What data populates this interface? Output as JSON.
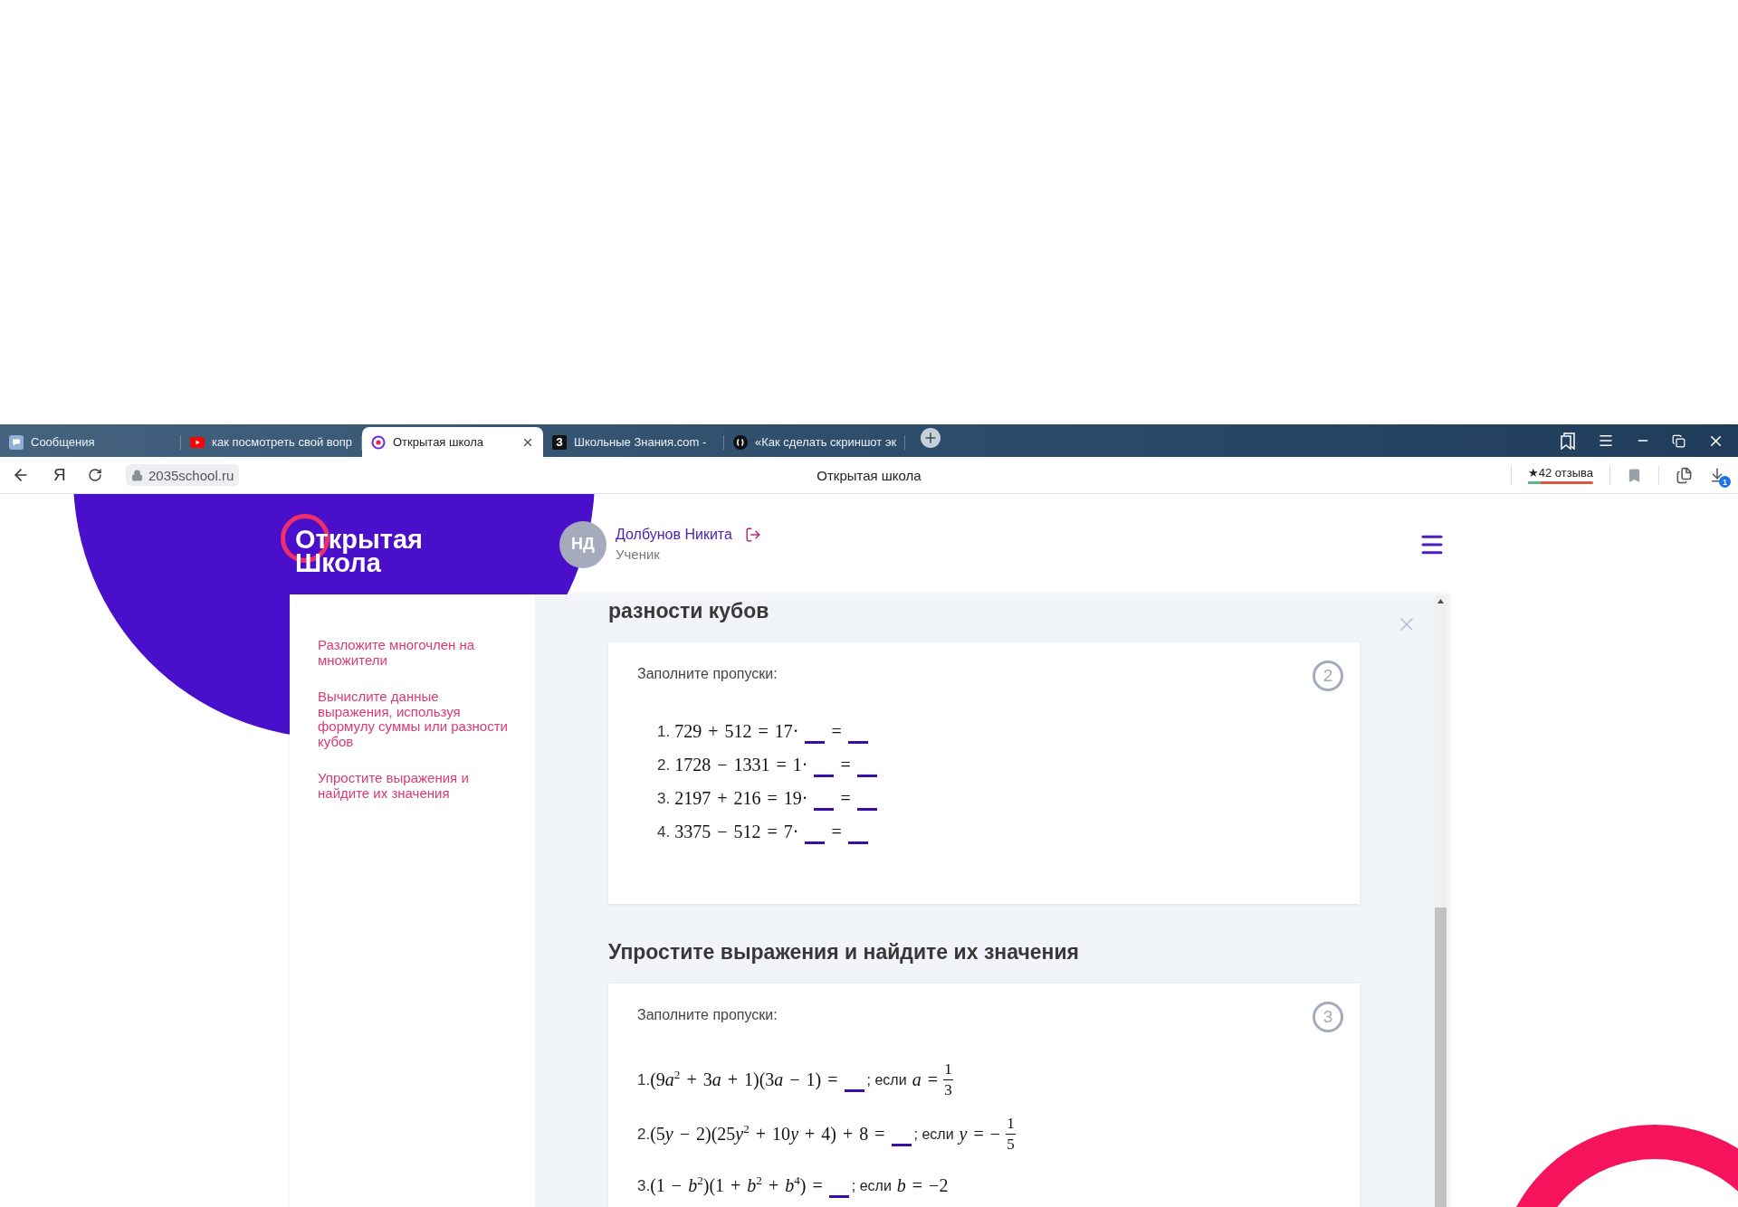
{
  "browser": {
    "tabs": [
      {
        "title": "Сообщения",
        "kind": "messages",
        "selected": false
      },
      {
        "title": "как посмотреть свой вопр",
        "kind": "video",
        "selected": false
      },
      {
        "title": "Открытая школа",
        "kind": "target",
        "selected": true
      },
      {
        "title": "Школьные Знания.com -",
        "kind": "letter",
        "letter": "З",
        "selected": false
      },
      {
        "title": "«Как сделать скриншот эк",
        "kind": "circle",
        "selected": false
      }
    ],
    "address_bar": {
      "home_letter": "Я",
      "url": "2035school.ru",
      "page_title": "Открытая школа",
      "reviews": {
        "label": "★42 отзыва",
        "level": 0.2
      },
      "download_badge": "1"
    }
  },
  "header": {
    "logo": [
      "Открытая",
      "Школа"
    ],
    "user": {
      "initials": "НД",
      "name": "Долбунов Никита",
      "role": "Ученик"
    }
  },
  "sidebar": {
    "items": [
      "Разложите многочлен на множители",
      "Вычислите данные выражения, используя формулу суммы или разности кубов",
      "Упростите выражения и найдите их значения"
    ]
  },
  "sections": [
    {
      "title": "разности кубов",
      "task": {
        "badge": "2",
        "prompt": "Заполните пропуски:",
        "indented": true,
        "items": [
          {
            "number": "1.",
            "parts": [
              {
                "kind": "math",
                "text": "729 + 512 = 17·"
              },
              {
                "kind": "blank"
              },
              {
                "kind": "math",
                "text": "="
              },
              {
                "kind": "blank"
              }
            ]
          },
          {
            "number": "2.",
            "parts": [
              {
                "kind": "math",
                "text": "1728 − 1331 = 1·"
              },
              {
                "kind": "blank"
              },
              {
                "kind": "math",
                "text": "="
              },
              {
                "kind": "blank"
              }
            ]
          },
          {
            "number": "3.",
            "parts": [
              {
                "kind": "math",
                "text": "2197 + 216 = 19·"
              },
              {
                "kind": "blank"
              },
              {
                "kind": "math",
                "text": "="
              },
              {
                "kind": "blank"
              }
            ]
          },
          {
            "number": "4.",
            "parts": [
              {
                "kind": "math",
                "text": "3375 − 512 = 7·"
              },
              {
                "kind": "blank"
              },
              {
                "kind": "math",
                "text": "="
              },
              {
                "kind": "blank"
              }
            ]
          }
        ]
      }
    },
    {
      "title": "Упростите выражения и найдите их значения",
      "task": {
        "badge": "3",
        "prompt": "Заполните пропуски:",
        "indented": false,
        "items": [
          {
            "number": "1.",
            "parts": [
              {
                "kind": "math",
                "text": "(9a$^{2}$ + 3a + 1)(3a − 1) ="
              },
              {
                "kind": "blank"
              },
              {
                "kind": "text",
                "text": "; если"
              },
              {
                "kind": "math",
                "text": "a ="
              },
              {
                "kind": "fraction",
                "numerator": "1",
                "denominator": "3"
              }
            ]
          },
          {
            "number": "2.",
            "parts": [
              {
                "kind": "math",
                "text": "(5y − 2)(25y$^{2}$ + 10y + 4) + 8 ="
              },
              {
                "kind": "blank"
              },
              {
                "kind": "text",
                "text": "; если"
              },
              {
                "kind": "math",
                "text": "y = −"
              },
              {
                "kind": "fraction",
                "numerator": "1",
                "denominator": "5"
              }
            ]
          },
          {
            "number": "3.",
            "parts": [
              {
                "kind": "math",
                "text": "(1 − b$^{2}$)(1 + b$^{2}$ + b$^{4}$) ="
              },
              {
                "kind": "blank"
              },
              {
                "kind": "text",
                "text": "; если"
              },
              {
                "kind": "math",
                "text": "b = −2"
              }
            ]
          }
        ]
      }
    }
  ]
}
